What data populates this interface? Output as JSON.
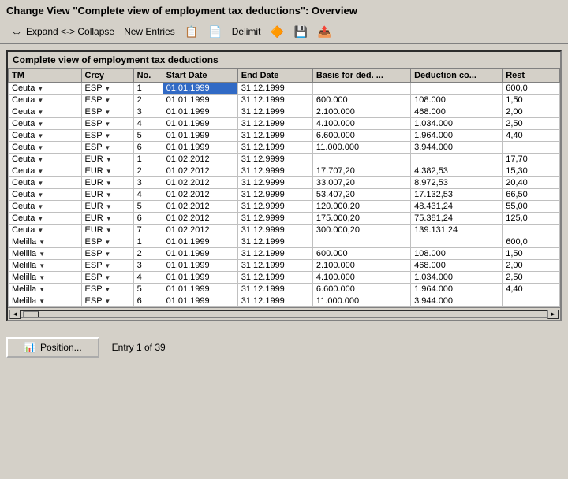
{
  "title": "Change View \"Complete view of employment tax deductions\": Overview",
  "toolbar": {
    "expand_collapse_label": "Expand <-> Collapse",
    "new_entries_label": "New Entries",
    "delimit_label": "Delimit"
  },
  "table": {
    "title": "Complete view of employment tax deductions",
    "columns": [
      "TM",
      "Crcy",
      "No.",
      "Start Date",
      "End Date",
      "Basis for ded. ...",
      "Deduction co...",
      "Rest"
    ],
    "rows": [
      {
        "tm": "Ceuta",
        "crcy": "ESP",
        "no": "1",
        "start": "01.01.1999",
        "end": "31.12.1999",
        "basis": "",
        "deduction": "",
        "rest": "600,0",
        "selected": true
      },
      {
        "tm": "Ceuta",
        "crcy": "ESP",
        "no": "2",
        "start": "01.01.1999",
        "end": "31.12.1999",
        "basis": "600.000",
        "deduction": "108.000",
        "rest": "1,50"
      },
      {
        "tm": "Ceuta",
        "crcy": "ESP",
        "no": "3",
        "start": "01.01.1999",
        "end": "31.12.1999",
        "basis": "2.100.000",
        "deduction": "468.000",
        "rest": "2,00"
      },
      {
        "tm": "Ceuta",
        "crcy": "ESP",
        "no": "4",
        "start": "01.01.1999",
        "end": "31.12.1999",
        "basis": "4.100.000",
        "deduction": "1.034.000",
        "rest": "2,50"
      },
      {
        "tm": "Ceuta",
        "crcy": "ESP",
        "no": "5",
        "start": "01.01.1999",
        "end": "31.12.1999",
        "basis": "6.600.000",
        "deduction": "1.964.000",
        "rest": "4,40"
      },
      {
        "tm": "Ceuta",
        "crcy": "ESP",
        "no": "6",
        "start": "01.01.1999",
        "end": "31.12.1999",
        "basis": "11.000.000",
        "deduction": "3.944.000",
        "rest": ""
      },
      {
        "tm": "Ceuta",
        "crcy": "EUR",
        "no": "1",
        "start": "01.02.2012",
        "end": "31.12.9999",
        "basis": "",
        "deduction": "",
        "rest": "17,70"
      },
      {
        "tm": "Ceuta",
        "crcy": "EUR",
        "no": "2",
        "start": "01.02.2012",
        "end": "31.12.9999",
        "basis": "17.707,20",
        "deduction": "4.382,53",
        "rest": "15,30"
      },
      {
        "tm": "Ceuta",
        "crcy": "EUR",
        "no": "3",
        "start": "01.02.2012",
        "end": "31.12.9999",
        "basis": "33.007,20",
        "deduction": "8.972,53",
        "rest": "20,40"
      },
      {
        "tm": "Ceuta",
        "crcy": "EUR",
        "no": "4",
        "start": "01.02.2012",
        "end": "31.12.9999",
        "basis": "53.407,20",
        "deduction": "17.132,53",
        "rest": "66,50"
      },
      {
        "tm": "Ceuta",
        "crcy": "EUR",
        "no": "5",
        "start": "01.02.2012",
        "end": "31.12.9999",
        "basis": "120.000,20",
        "deduction": "48.431,24",
        "rest": "55,00"
      },
      {
        "tm": "Ceuta",
        "crcy": "EUR",
        "no": "6",
        "start": "01.02.2012",
        "end": "31.12.9999",
        "basis": "175.000,20",
        "deduction": "75.381,24",
        "rest": "125,0"
      },
      {
        "tm": "Ceuta",
        "crcy": "EUR",
        "no": "7",
        "start": "01.02.2012",
        "end": "31.12.9999",
        "basis": "300.000,20",
        "deduction": "139.131,24",
        "rest": ""
      },
      {
        "tm": "Melilla",
        "crcy": "ESP",
        "no": "1",
        "start": "01.01.1999",
        "end": "31.12.1999",
        "basis": "",
        "deduction": "",
        "rest": "600,0"
      },
      {
        "tm": "Melilla",
        "crcy": "ESP",
        "no": "2",
        "start": "01.01.1999",
        "end": "31.12.1999",
        "basis": "600.000",
        "deduction": "108.000",
        "rest": "1,50"
      },
      {
        "tm": "Melilla",
        "crcy": "ESP",
        "no": "3",
        "start": "01.01.1999",
        "end": "31.12.1999",
        "basis": "2.100.000",
        "deduction": "468.000",
        "rest": "2,00"
      },
      {
        "tm": "Melilla",
        "crcy": "ESP",
        "no": "4",
        "start": "01.01.1999",
        "end": "31.12.1999",
        "basis": "4.100.000",
        "deduction": "1.034.000",
        "rest": "2,50"
      },
      {
        "tm": "Melilla",
        "crcy": "ESP",
        "no": "5",
        "start": "01.01.1999",
        "end": "31.12.1999",
        "basis": "6.600.000",
        "deduction": "1.964.000",
        "rest": "4,40"
      },
      {
        "tm": "Melilla",
        "crcy": "ESP",
        "no": "6",
        "start": "01.01.1999",
        "end": "31.12.1999",
        "basis": "11.000.000",
        "deduction": "3.944.000",
        "rest": ""
      }
    ]
  },
  "bottom": {
    "position_label": "Position...",
    "entry_info": "Entry 1 of 39"
  }
}
